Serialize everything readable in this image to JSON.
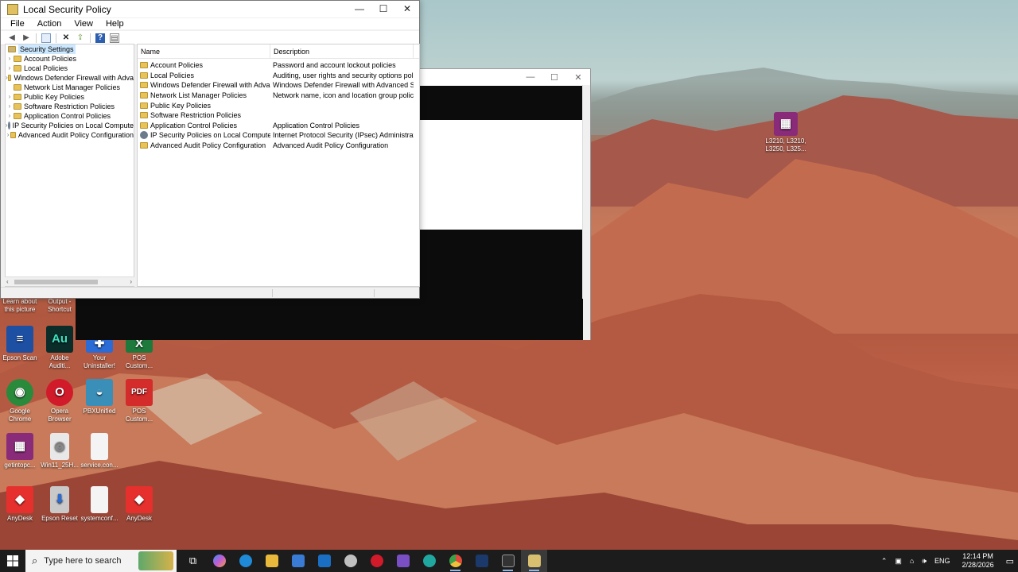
{
  "window": {
    "title": "Local Security Policy",
    "controls": {
      "minimize": "—",
      "maximize": "☐",
      "close": "✕"
    },
    "menu": [
      "File",
      "Action",
      "View",
      "Help"
    ],
    "tree": {
      "root": "Security Settings",
      "items": [
        {
          "label": "Account Policies",
          "icon": "folder-icon"
        },
        {
          "label": "Local Policies",
          "icon": "folder-icon"
        },
        {
          "label": "Windows Defender Firewall with Adva",
          "icon": "folder-icon"
        },
        {
          "label": "Network List Manager Policies",
          "icon": "folder-icon"
        },
        {
          "label": "Public Key Policies",
          "icon": "folder-icon"
        },
        {
          "label": "Software Restriction Policies",
          "icon": "folder-icon"
        },
        {
          "label": "Application Control Policies",
          "icon": "folder-icon"
        },
        {
          "label": "IP Security Policies on Local Compute",
          "icon": "shield-icon"
        },
        {
          "label": "Advanced Audit Policy Configuration",
          "icon": "folder-icon"
        }
      ]
    },
    "list": {
      "columns": [
        "Name",
        "Description"
      ],
      "rows": [
        {
          "name": "Account Policies",
          "desc": "Password and account lockout policies",
          "icon": "folder-icon"
        },
        {
          "name": "Local Policies",
          "desc": "Auditing, user rights and security options polici...",
          "icon": "folder-icon"
        },
        {
          "name": "Windows Defender Firewall with Advanc...",
          "desc": "Windows Defender Firewall with Advanced Sec...",
          "icon": "folder-icon"
        },
        {
          "name": "Network List Manager Policies",
          "desc": "Network name, icon and location group policies.",
          "icon": "folder-icon"
        },
        {
          "name": "Public Key Policies",
          "desc": "",
          "icon": "folder-icon"
        },
        {
          "name": "Software Restriction Policies",
          "desc": "",
          "icon": "folder-icon"
        },
        {
          "name": "Application Control Policies",
          "desc": "Application Control Policies",
          "icon": "folder-icon"
        },
        {
          "name": "IP Security Policies on Local Computer",
          "desc": "Internet Protocol Security (IPsec) Administratio...",
          "icon": "shield-icon"
        },
        {
          "name": "Advanced Audit Policy Configuration",
          "desc": "Advanced Audit Policy Configuration",
          "icon": "folder-icon"
        }
      ]
    }
  },
  "desktop": {
    "icons": [
      {
        "label": "Learn about this picture",
        "color": "transparent",
        "glyph": ""
      },
      {
        "label": "Output - Shortcut",
        "color": "transparent",
        "glyph": ""
      },
      {
        "label": "Epson Scan",
        "color": "#1d4fa3",
        "glyph": "≡"
      },
      {
        "label": "Adobe Auditi...",
        "color": "#0b2d2a",
        "glyph": "Au"
      },
      {
        "label": "Your Uninstaller!",
        "color": "#2a6bd6",
        "glyph": "✚"
      },
      {
        "label": "POS Custom...",
        "color": "#1e7a3c",
        "glyph": "X"
      },
      {
        "label": "Google Chrome",
        "color": "#2a8a3c",
        "glyph": "◉"
      },
      {
        "label": "Opera Browser",
        "color": "#d11a2a",
        "glyph": "O"
      },
      {
        "label": "PBXUnified",
        "color": "#3a8fb8",
        "glyph": "◒"
      },
      {
        "label": "POS Custom...",
        "color": "#d42b2b",
        "glyph": "PDF"
      },
      {
        "label": "getintopc...",
        "color": "#8a2b7a",
        "glyph": "▦"
      },
      {
        "label": "Win11_25H...",
        "color": "#e8e8e8",
        "glyph": "◎"
      },
      {
        "label": "service.con...",
        "color": "#f4f4f4",
        "glyph": ""
      },
      {
        "label": "AnyDesk",
        "color": "#e5302e",
        "glyph": "◆"
      },
      {
        "label": "Epson Reset",
        "color": "#c9c9c9",
        "glyph": "⬇"
      },
      {
        "label": "systemconf...",
        "color": "#f4f4f4",
        "glyph": ""
      },
      {
        "label": "AnyDesk",
        "color": "#e5302e",
        "glyph": "◆"
      },
      {
        "label": "L3210, L3210, L3250, L325...",
        "color": "#8a2b7a",
        "glyph": "▦"
      }
    ]
  },
  "taskbar": {
    "search_placeholder": "Type here to search",
    "apps": [
      {
        "name": "task-view-icon",
        "color": "#1c1c1c",
        "glyph": "⧉"
      },
      {
        "name": "copilot-icon",
        "color": "#7b5bd6",
        "glyph": ""
      },
      {
        "name": "edge-icon",
        "color": "#1f8ad8",
        "glyph": ""
      },
      {
        "name": "file-explorer-icon",
        "color": "#e8b93a",
        "glyph": ""
      },
      {
        "name": "store-icon",
        "color": "#3a7bd5",
        "glyph": ""
      },
      {
        "name": "outlook-icon",
        "color": "#1a6fc4",
        "glyph": ""
      },
      {
        "name": "app-icon",
        "color": "#c0c0c0",
        "glyph": ""
      },
      {
        "name": "opera-icon",
        "color": "#d11a2a",
        "glyph": ""
      },
      {
        "name": "visual-studio-icon",
        "color": "#7b4fc4",
        "glyph": ""
      },
      {
        "name": "edge-browser-icon",
        "color": "#1fa7a0",
        "glyph": ""
      },
      {
        "name": "chrome-icon",
        "color": "#3aa04a",
        "glyph": ""
      },
      {
        "name": "powershell-icon",
        "color": "#1b3a6b",
        "glyph": ""
      },
      {
        "name": "terminal-icon",
        "color": "#333333",
        "glyph": ""
      },
      {
        "name": "local-security-policy-icon",
        "color": "#d8c070",
        "glyph": ""
      }
    ],
    "language": "ENG",
    "time": "12:14 PM",
    "date": "2/28/2026"
  }
}
